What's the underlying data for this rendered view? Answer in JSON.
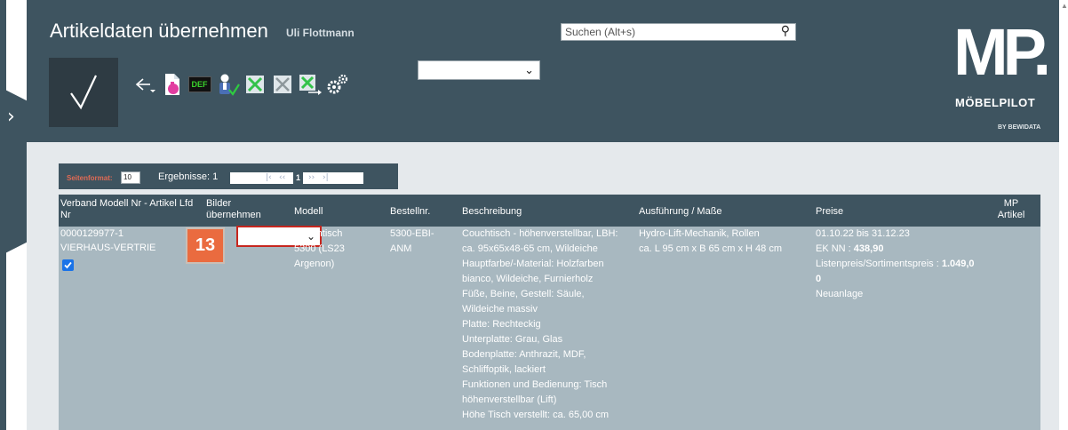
{
  "header": {
    "title": "Artikeldaten übernehmen",
    "user": "Uli Flottmann",
    "search_placeholder": "Suchen (Alt+s)",
    "def_label": "DEF",
    "toolbar_select_value": ""
  },
  "logo": {
    "mark": "MP.",
    "name": "MÖBELPILOT",
    "by": "BY BEWIDATA"
  },
  "pager": {
    "seitenformat_label": "Seitenformat:",
    "seitenformat_value": "10",
    "ergebnisse": "Ergebnisse: 1",
    "first": "|‹",
    "prev": "‹‹",
    "current_page": "1",
    "next": "››",
    "last": "›|"
  },
  "table": {
    "headers": {
      "verband": "Verband Modell Nr - Artikel Lfd Nr",
      "bilder": "Bilder übernehmen",
      "modell": "Modell",
      "bestellnr": "Bestellnr.",
      "beschreibung": "Beschreibung",
      "ausfuehrung": "Ausführung / Maße",
      "preise": "Preise",
      "mp_artikel": "MP Artikel"
    },
    "row": {
      "artikel_nr": "0000129977-1",
      "lieferant": "VIERHAUS-VERTRIE",
      "checked": true,
      "bilder_value": "",
      "modell_line1": "Couchtisch",
      "modell_line2": "5300 (LS23",
      "modell_line3": "Argenon)",
      "bestell_line1": "5300-EBI-",
      "bestell_line2": "ANM",
      "beschreibung": [
        "Couchtisch - höhenverstellbar, LBH:",
        "ca. 95x65x48-65 cm, Wildeiche",
        "Hauptfarbe/-Material: Holzfarben",
        "bianco, Wildeiche, Furnierholz",
        "Füße, Beine, Gestell: Säule,",
        "Wildeiche massiv",
        "Platte: Rechteckig",
        "Unterplatte: Grau, Glas",
        "Bodenplatte: Anthrazit, MDF,",
        "Schliffoptik, lackiert",
        "Funktionen und Bedienung: Tisch",
        "höhenverstellbar (Lift)",
        "Höhe Tisch verstellt: ca. 65,00 cm"
      ],
      "ausfuehrung_line1": "Hydro-Lift-Mechanik, Rollen",
      "ausfuehrung_line2": "ca. L 95 cm x B 65 cm x H 48 cm",
      "preise_zeitraum": "01.10.22 bis 31.12.23",
      "ek_label": "EK NN : ",
      "ek_value": "438,90",
      "listenpreis_label": "Listenpreis/Sortimentspreis : ",
      "listenpreis_value_part1": "1.049,0",
      "listenpreis_value_part2": "0",
      "status": "Neuanlage"
    }
  },
  "step_badge": "13",
  "colors": {
    "header_bg": "#3e5460",
    "content_bg": "#e5e9ec",
    "row_bg": "#a8b8c0",
    "badge": "#ea6b3f",
    "highlight_border": "#c6261e",
    "accent_label": "#e06a54"
  }
}
